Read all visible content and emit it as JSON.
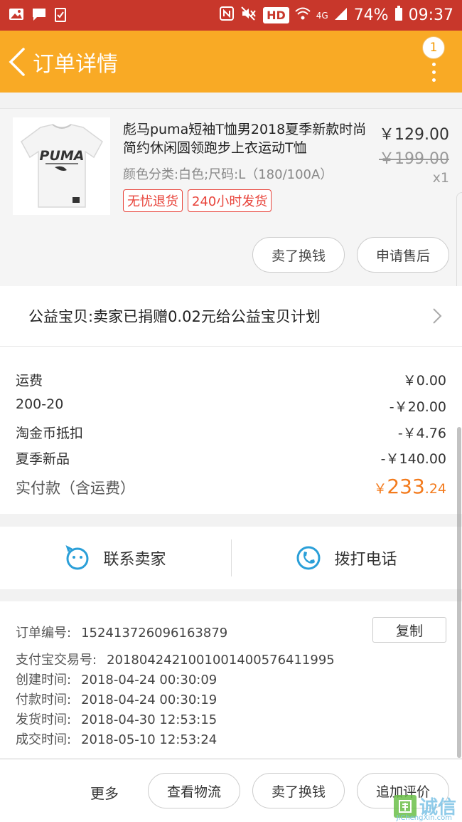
{
  "status_bar": {
    "network": "4G",
    "hd": "HD",
    "battery": "74%",
    "time": "09:37"
  },
  "header": {
    "title": "订单详情",
    "badge_count": "1"
  },
  "product": {
    "name": "彪马puma短袖T恤男2018夏季新款时尚简约休闲圆领跑步上衣运动T恤",
    "spec": "颜色分类:白色;尺码:L（180/100A）",
    "tags": [
      "无忧退货",
      "240小时发货"
    ],
    "price": "￥129.00",
    "original_price": "￥199.00",
    "quantity": "x1",
    "logo_text": "PUMA",
    "buttons": {
      "sell_label": "卖了换钱",
      "after_sale_label": "申请售后"
    }
  },
  "charity": {
    "text": "公益宝贝:卖家已捐赠0.02元给公益宝贝计划"
  },
  "fees": {
    "rows": [
      {
        "label": "运费",
        "value": "￥0.00"
      },
      {
        "label": "200-20",
        "value": "-￥20.00"
      },
      {
        "label": "淘金币抵扣",
        "value": "-￥4.76"
      },
      {
        "label": "夏季新品",
        "value": "-￥140.00"
      }
    ],
    "total_label": "实付款（含运费）",
    "total_currency": "￥",
    "total_int": "233",
    "total_dec": ".24"
  },
  "contact": {
    "seller_label": "联系卖家",
    "phone_label": "拨打电话"
  },
  "order_info": {
    "copy_label": "复制",
    "rows": [
      {
        "label": "订单编号:",
        "value": "152413726096163879"
      },
      {
        "label": "支付宝交易号:",
        "value": "2018042421001001400576411995"
      },
      {
        "label": "创建时间:",
        "value": "2018-04-24 00:30:09"
      },
      {
        "label": "付款时间:",
        "value": "2018-04-24 00:30:19"
      },
      {
        "label": "发货时间:",
        "value": "2018-04-30 12:53:15"
      },
      {
        "label": "成交时间:",
        "value": "2018-05-10 12:53:24"
      }
    ]
  },
  "bottom_bar": {
    "more_label": "更多",
    "logistics_label": "查看物流",
    "sell_label": "卖了换钱",
    "review_label": "追加评价"
  },
  "watermark": {
    "text": "诚信",
    "sub": "JiChengXin.com"
  },
  "colors": {
    "status_bar": "#c8372b",
    "header": "#f9aa25",
    "accent_orange": "#f37b1d",
    "tag_red": "#e8433a",
    "icon_blue": "#2a9fd8"
  }
}
